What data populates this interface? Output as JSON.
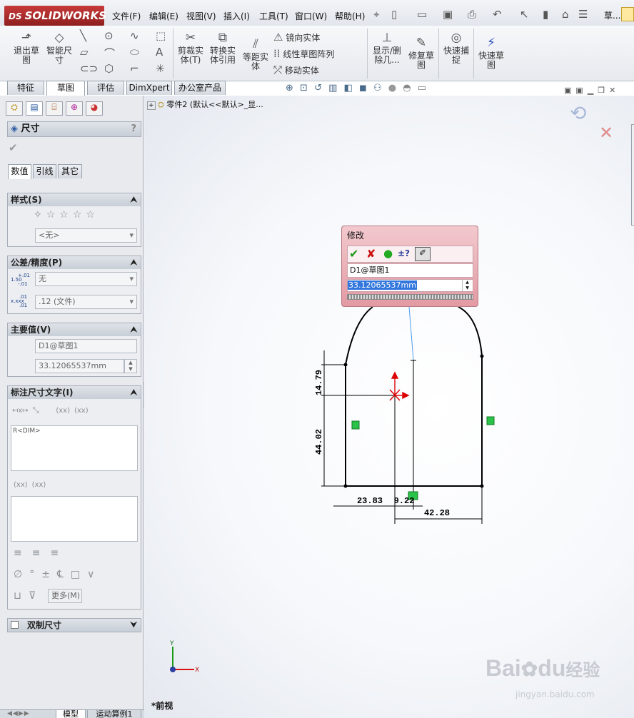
{
  "app": {
    "brand_mark": "DS",
    "brand_name": "SOLIDWORKS",
    "right_title": "草..."
  },
  "menu": [
    "文件(F)",
    "编辑(E)",
    "视图(V)",
    "插入(I)",
    "工具(T)",
    "窗口(W)",
    "帮助(H)"
  ],
  "ribbon": {
    "exit_sketch": [
      "退出草",
      "图"
    ],
    "smart_dimension": [
      "智能尺",
      "寸"
    ],
    "trim_entities": [
      "剪裁实",
      "体(T)"
    ],
    "convert_entities": [
      "转换实",
      "体引用"
    ],
    "offset_entities": [
      "等距实",
      "体"
    ],
    "mirror_entities": "镜向实体",
    "linear_pattern": "线性草图阵列",
    "move_entities": "移动实体",
    "display_delete_relations": [
      "显示/删",
      "除几..."
    ],
    "repair_sketch": [
      "修复草",
      "图"
    ],
    "quick_snaps": [
      "快速捕",
      "捉"
    ],
    "rapid_sketch": [
      "快速草",
      "图"
    ]
  },
  "command_tabs": [
    "特征",
    "草图",
    "评估",
    "DimXpert",
    "办公室产品"
  ],
  "feature_tree": {
    "root": "零件2  (默认<<默认>_显..."
  },
  "property_manager": {
    "title": "尺寸",
    "help": "?",
    "subtabs": [
      "数值",
      "引线",
      "其它"
    ],
    "style": {
      "header": "样式(S)",
      "value": "<无>"
    },
    "tolerance": {
      "header": "公差/精度(P)",
      "tolerance_value": "无",
      "precision_value": ".12 (文件)",
      "tol_icon_top": "1.50",
      "tol_icon_sup": "+.01",
      "tol_icon_sub": "-.01",
      "prec_icon": "x.xxx",
      "prec_sup": ".01",
      "prec_sub": ".01"
    },
    "primary_value": {
      "header": "主要值(V)",
      "name": "D1@草图1",
      "value": "33.12065537mm"
    },
    "dim_text": {
      "header": "标注尺寸文字(I)",
      "text": "R<DIM>",
      "xx": "(xx)",
      "more_button": "更多(M)"
    },
    "dual_dimension": {
      "header": "双制尺寸"
    }
  },
  "modify_dialog": {
    "title": "修改",
    "dimension_name": "D1@草图1",
    "value": "33.12065537mm",
    "help_symbol": "±?"
  },
  "sketch": {
    "dimensions": [
      {
        "label": "14.79"
      },
      {
        "label": "44.02"
      },
      {
        "label": "23.83"
      },
      {
        "label": "9.22"
      },
      {
        "label": "42.28"
      }
    ]
  },
  "triad": {
    "x": "X",
    "y": "Y"
  },
  "view_label": "*前视",
  "bottom_tabs": [
    "模型",
    "运动算例1"
  ],
  "watermark": {
    "main": "Bai",
    "middle": "du",
    "cn": "经验",
    "url": "jingyan.baidu.com"
  }
}
